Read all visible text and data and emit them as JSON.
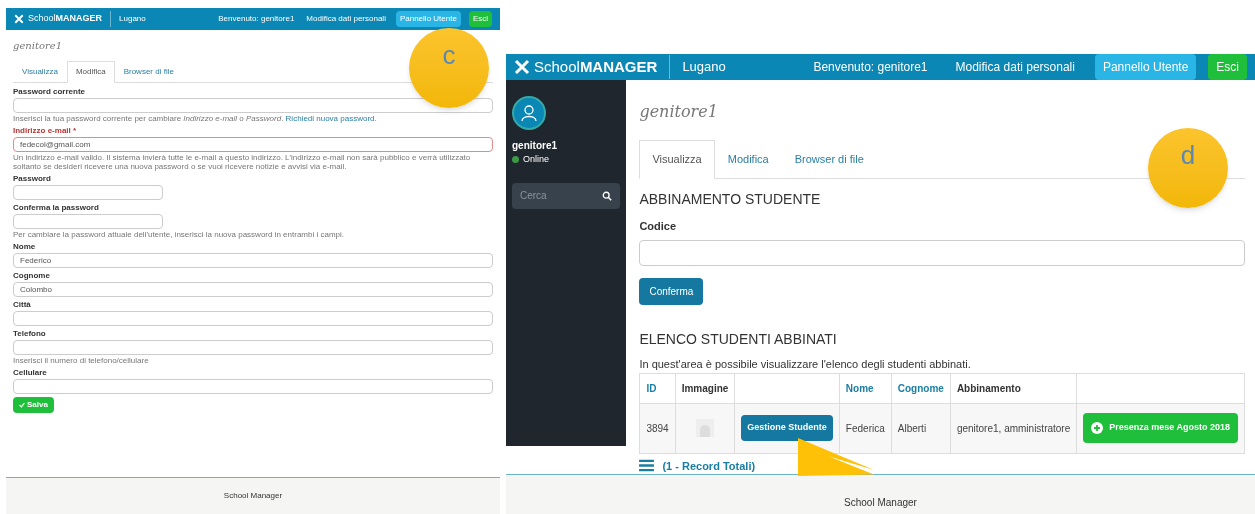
{
  "panel_c": {
    "badge": "c",
    "header": {
      "logo": "School**MANAGER**",
      "city": "Lugano",
      "links": [
        "Benvenuto: genitore1",
        "Modifica dati personali"
      ],
      "buttons": [
        {
          "label": "Pannello Utente",
          "kind": "info"
        },
        {
          "label": "Esci",
          "kind": "success"
        }
      ]
    },
    "title": "genitore1",
    "tabs": [
      {
        "label": "Visualizza",
        "selected": false
      },
      {
        "label": "Modifica",
        "selected": true
      },
      {
        "label": "Browser di file",
        "selected": false
      }
    ],
    "fields": [
      {
        "label": "Password corrente",
        "error": false,
        "help": "Inserisci la tua password corrente per cambiare *Indirizzo e-mail* o *Password*.",
        "link": "Richiedi nuova password."
      },
      {
        "label": "Indirizzo e-mail *",
        "error": true,
        "value": "fedecol@gmail.com",
        "help": "Un indirizzo e-mail valido. Il sistema invierà tutte le e-mail a questo indirizzo. L'indirizzo e-mail non sarà pubblico e verrà utilizzato soltanto se desideri ricevere una nuova password o se vuoi ricevere notizie e avvisi via e-mail."
      },
      {
        "label": "Password",
        "kind": "short",
        "error": false
      },
      {
        "label": "Conferma la password",
        "kind": "short",
        "error": false,
        "help": "Per cambiare la password attuale dell'utente, inserisci la nuova password in entrambi i campi."
      },
      {
        "label": "Nome",
        "error": false,
        "value": "Federico"
      },
      {
        "label": "Cognome",
        "error": false,
        "value": "Colombo"
      },
      {
        "label": "Città",
        "error": false
      },
      {
        "label": "Telefono",
        "error": false,
        "help": "Inserisci il numero di telefono/cellulare"
      },
      {
        "label": "Cellulare",
        "error": false
      }
    ],
    "save_button": "Salva",
    "footer": "School Manager"
  },
  "panel_d": {
    "badge": "d",
    "header": {
      "logo": "School**MANAGER**",
      "city": "Lugano",
      "links": [
        "Benvenuto: genitore1",
        "Modifica dati personali"
      ],
      "buttons": [
        {
          "label": "Pannello Utente",
          "kind": "info"
        },
        {
          "label": "Esci",
          "kind": "success"
        }
      ]
    },
    "sidebar": {
      "user": "genitore1",
      "status": "Online",
      "online": true,
      "search": {
        "placeholder": "Cerca"
      }
    },
    "title": "genitore1",
    "tabs": [
      {
        "label": "Visualizza",
        "selected": true
      },
      {
        "label": "Modifica",
        "selected": false
      },
      {
        "label": "Browser di file",
        "selected": false
      }
    ],
    "pairing": {
      "heading": "ABBINAMENTO STUDENTE",
      "label": "Codice",
      "button": "Conferma"
    },
    "list": {
      "heading": "ELENCO STUDENTI ABBINATI",
      "description": "In quest'area è possibile visualizzare l'elenco degli studenti abbinati.",
      "columns": [
        {
          "kind": "sort_link",
          "label": "ID"
        },
        {
          "kind": "text",
          "label": "Immagine"
        },
        {
          "kind": "blank"
        },
        {
          "kind": "sort_link",
          "label": "Nome"
        },
        {
          "kind": "sort_link",
          "label": "Cognome"
        },
        {
          "kind": "text",
          "label": "Abbinamento"
        },
        {
          "kind": "blank"
        }
      ],
      "rows": [
        {
          "id": "3894",
          "action": "Gestione Studente",
          "nome": "Federica",
          "cognome": "Alberti",
          "abbinamento": "genitore1, amministratore",
          "presence": "Presenza mese Agosto 2018"
        }
      ],
      "total": "(1 - Record Totali)"
    },
    "footer": "School Manager"
  }
}
